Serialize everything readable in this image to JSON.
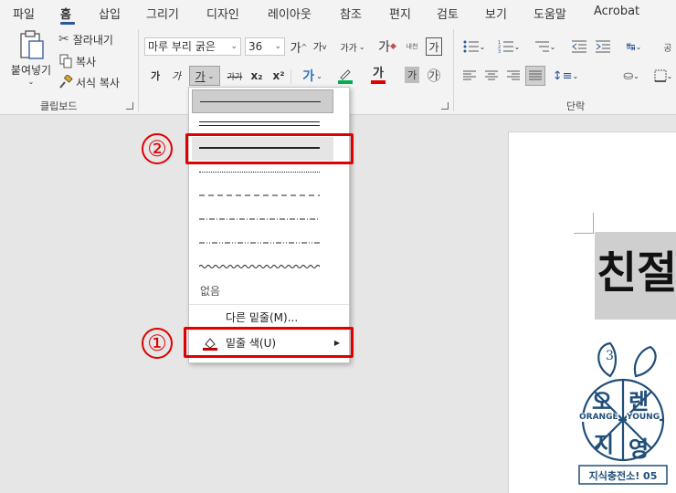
{
  "tabs": [
    {
      "label": "파일"
    },
    {
      "label": "홈"
    },
    {
      "label": "삽입"
    },
    {
      "label": "그리기"
    },
    {
      "label": "디자인"
    },
    {
      "label": "레이아웃"
    },
    {
      "label": "참조"
    },
    {
      "label": "편지"
    },
    {
      "label": "검토"
    },
    {
      "label": "보기"
    },
    {
      "label": "도움말"
    },
    {
      "label": "Acrobat"
    }
  ],
  "clipboard": {
    "paste_label": "붙여넣기",
    "cut_label": "잘라내기",
    "copy_label": "복사",
    "format_painter_label": "서식 복사",
    "group_label": "클립보드"
  },
  "font": {
    "font_name": "마루 부리 굵은",
    "font_size": "36",
    "grow_label": "가",
    "shrink_label": "가",
    "case_label": "가가",
    "clear_label": "가",
    "phonetic_label": "내천",
    "border_char_label": "가",
    "bold_label": "가",
    "italic_label": "가",
    "underline_label": "가",
    "strike_label": "가가",
    "subscript_label": "x₂",
    "superscript_label": "x²",
    "effects_label": "가",
    "fontcolor_label": "가",
    "shade_label": "가",
    "enclose_label": "㉮"
  },
  "paragraph": {
    "group_label": "단락"
  },
  "underline_menu": {
    "options": [
      {
        "style": "single",
        "selected": true
      },
      {
        "style": "double",
        "selected": false
      },
      {
        "style": "thick",
        "selected": false,
        "highlighted": true
      },
      {
        "style": "dotted",
        "selected": false
      },
      {
        "style": "dashed",
        "selected": false
      },
      {
        "style": "dash-dot",
        "selected": false
      },
      {
        "style": "dash-dot-dot",
        "selected": false
      },
      {
        "style": "wave",
        "selected": false
      }
    ],
    "none_label": "없음",
    "more_label": "다른 밑줄(M)...",
    "color_label": "밑줄 색(U)"
  },
  "annotations": {
    "marker_1": "①",
    "marker_2": "②"
  },
  "document": {
    "title_text": "친절",
    "logo_lines": [
      "오",
      "렌",
      "지",
      "영"
    ],
    "logo_number": "3",
    "logo_left_word": "ORANGE",
    "logo_right_word": "YOUNG",
    "logo_caption": "지식충전소! 05"
  },
  "colors": {
    "accent": "#2b579a",
    "highlight_red": "#e00000",
    "underline_color": "#c00000",
    "font_color": "#e00000",
    "highlight_green": "#00b050",
    "logo_blue": "#1f4e79"
  }
}
